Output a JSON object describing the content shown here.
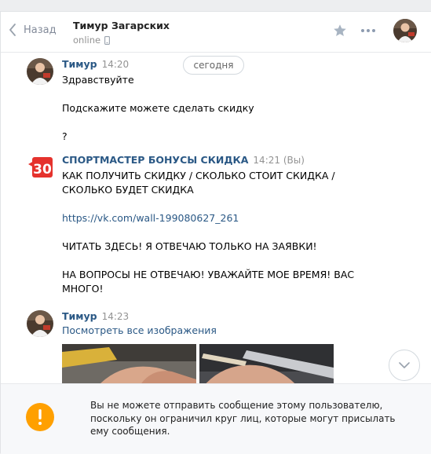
{
  "header": {
    "back_label": "Назад",
    "peer_name": "Тимур Загарских",
    "peer_status": "online"
  },
  "history": {
    "date_label": "сегодня",
    "messages": [
      {
        "author": "Тимур",
        "time": "14:20",
        "text": "Здравствуйте\n\nПодскажите можете сделать скидку\n\n?"
      },
      {
        "author": "СПОРТМАСТЕР БОНУСЫ СКИДКА",
        "time": "14:21 (Вы)",
        "avatar_text": "30",
        "text_top": "КАК ПОЛУЧИТЬ СКИДКУ / СКОЛЬКО СТОИТ СКИДКА /\nСКОЛЬКО БУДЕТ СКИДКА",
        "link": "https://vk.com/wall-199080627_261",
        "text_bottom": "ЧИТАТЬ ЗДЕСЬ! Я ОТВЕЧАЮ ТОЛЬКО НА ЗАЯВКИ!\n\nНА ВОПРОСЫ НЕ ОТВЕЧАЮ! УВАЖАЙТЕ МОЕ ВРЕМЯ! ВАС\nМНОГО!"
      },
      {
        "author": "Тимур",
        "time": "14:23",
        "view_all_label": "Посмотреть все изображения"
      }
    ]
  },
  "notice": {
    "text": "Вы не можете отправить сообщение этому пользователю, поскольку он ограничил круг лиц, которые могут присылать ему сообщения."
  },
  "colors": {
    "link": "#2a5885",
    "muted": "#939393",
    "warning": "#ffa000",
    "brand_red": "#e5322d"
  }
}
